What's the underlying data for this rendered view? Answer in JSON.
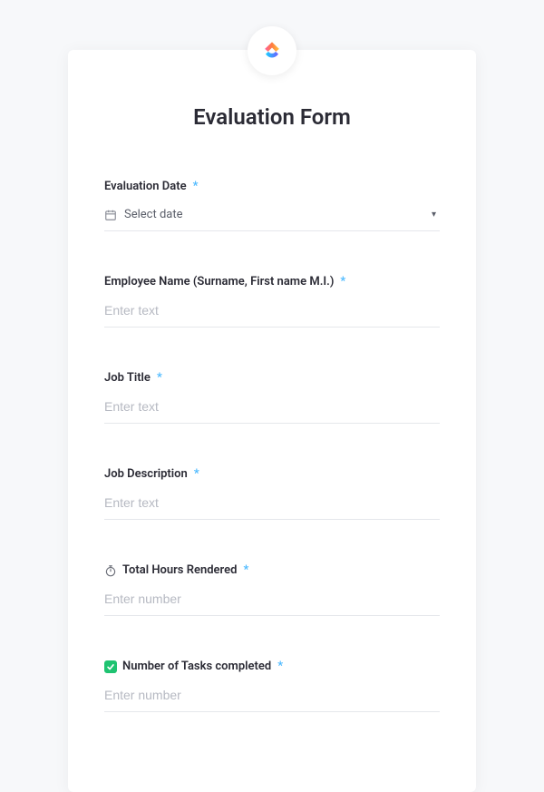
{
  "title": "Evaluation Form",
  "required_marker": "*",
  "fields": {
    "eval_date": {
      "label": "Evaluation Date",
      "placeholder": "Select date"
    },
    "employee_name": {
      "label": "Employee Name (Surname, First name M.I.)",
      "placeholder": "Enter text"
    },
    "job_title": {
      "label": "Job Title",
      "placeholder": "Enter text"
    },
    "job_description": {
      "label": "Job Description",
      "placeholder": "Enter text"
    },
    "total_hours": {
      "label": "Total Hours Rendered",
      "placeholder": "Enter number"
    },
    "tasks_completed": {
      "label": "Number of Tasks completed",
      "placeholder": "Enter number"
    }
  },
  "colors": {
    "accent_blue": "#49b8ff",
    "check_green": "#1fc371"
  }
}
